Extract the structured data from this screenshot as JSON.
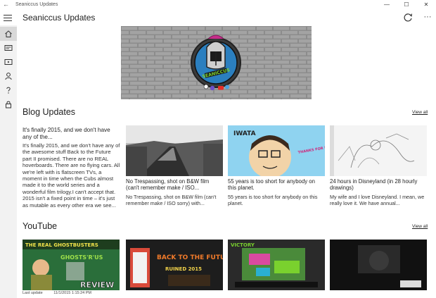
{
  "window": {
    "title": "Seaniccus Updates",
    "back": "←",
    "minimize": "—",
    "maximize": "☐",
    "close": "✕"
  },
  "appbar": {
    "title": "Seaniccus Updates",
    "more": "···"
  },
  "banner": {
    "logo_text": "SEANICCUS"
  },
  "blog": {
    "title": "Blog Updates",
    "view_all": "View all",
    "featured": {
      "headline": "It's finally 2015, and we don't have any of the...",
      "summary": "It's finally 2015, and we don't have any of the awesome stuff Back to the Future part II promised. There are no REAL hoverboards. There are no flying cars. All we're left with is flatscreen TVs, a moment in time when the Cubs almost made it to the world series and a wonderful film trilogy.I can't accept that. 2015 isn't a fixed point in time – it's just as mutable as every other era we see..."
    },
    "cards": [
      {
        "title": "No Trespassing, shot on B&W film (can't remember make / ISO...",
        "summary": "No Trespassing, shot on B&W film (can't remember make / ISO sorry) with..."
      },
      {
        "title": "55 years is too short for anybody on this planet.",
        "summary": "55 years is too short for anybody on this planet.",
        "image_text": "IWATA",
        "image_caption": "THANKS FOR PLAYING WITH ME"
      },
      {
        "title": "24 hours in Disneyland (in 28 hourly drawings)",
        "summary": "My wife and I love Disneyland. I mean, we really love it. We have annual..."
      }
    ]
  },
  "youtube": {
    "title": "YouTube",
    "view_all": "View all",
    "thumbs": [
      {
        "caption": "THE REAL GHOSTBUSTERS",
        "badge": "REVIEW",
        "extra": "GHOSTS'R'US"
      },
      {
        "caption": "BACK TO THE FUTURE III",
        "extra": "RUINED 2015"
      },
      {
        "caption": "VICTORY"
      },
      {
        "caption": ""
      }
    ]
  },
  "footer": {
    "label": "Last update",
    "value": "11/1/2015 1:15:24 PM"
  },
  "colors": {
    "rail": "#f2f2f2",
    "rail_active": "#d9d9d9",
    "accent_red": "#c8102e",
    "brick": "#8a8a8a"
  }
}
